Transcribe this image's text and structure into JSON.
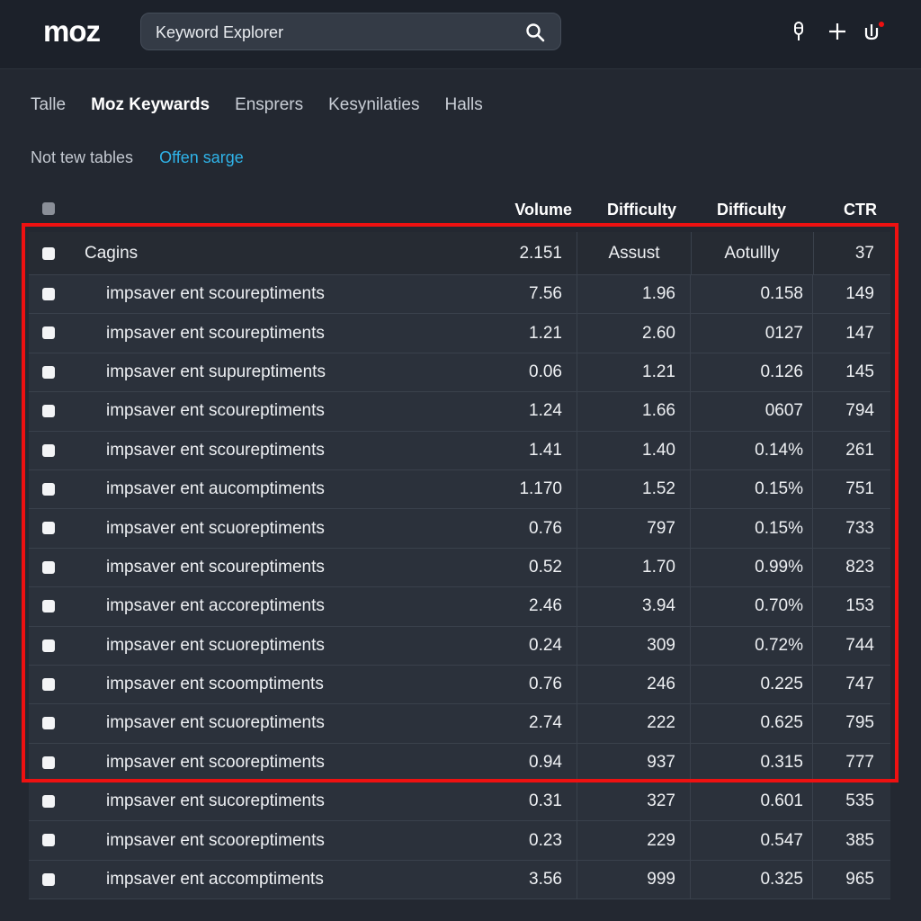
{
  "app": {
    "logo": "moz",
    "search_placeholder": "Keyword Explorer"
  },
  "icons": {
    "search": "search-icon",
    "microphone": "microphone-icon",
    "add": "plus-icon",
    "notifications": "notification-icon"
  },
  "colors": {
    "accent_link": "#2fb3e8",
    "highlight": "#ee1111"
  },
  "tabs": [
    {
      "label": "Talle",
      "active": false
    },
    {
      "label": "Moz Keywards",
      "active": true
    },
    {
      "label": "Ensprers",
      "active": false
    },
    {
      "label": "Kesynilaties",
      "active": false
    },
    {
      "label": "Halls",
      "active": false
    }
  ],
  "subrow": {
    "text": "Not tew tables",
    "link": "Offen sarge"
  },
  "table": {
    "columns": [
      "Volume",
      "Difficulty",
      "Difficulty",
      "CTR"
    ],
    "group_row": {
      "keyword": "Cagins",
      "c1": "2.151",
      "c2": "Assust",
      "c3": "Aotullly",
      "c4": "37"
    },
    "rows": [
      {
        "keyword": "impsaver ent scoureptiments",
        "c1": "7.56",
        "c2": "1.96",
        "c3": "0.158",
        "c4": "149"
      },
      {
        "keyword": "impsaver ent scoureptiments",
        "c1": "1.21",
        "c2": "2.60",
        "c3": "0127",
        "c4": "147"
      },
      {
        "keyword": "impsaver ent supureptiments",
        "c1": "0.06",
        "c2": "1.21",
        "c3": "0.126",
        "c4": "145"
      },
      {
        "keyword": "impsaver ent scoureptiments",
        "c1": "1.24",
        "c2": "1.66",
        "c3": "0607",
        "c4": "794"
      },
      {
        "keyword": "impsaver ent scoureptiments",
        "c1": "1.41",
        "c2": "1.40",
        "c3": "0.14%",
        "c4": "261"
      },
      {
        "keyword": "impsaver ent aucomptiments",
        "c1": "1.170",
        "c2": "1.52",
        "c3": "0.15%",
        "c4": "751"
      },
      {
        "keyword": "impsaver ent scuoreptiments",
        "c1": "0.76",
        "c2": "797",
        "c3": "0.15%",
        "c4": "733"
      },
      {
        "keyword": "impsaver ent scoureptiments",
        "c1": "0.52",
        "c2": "1.70",
        "c3": "0.99%",
        "c4": "823"
      },
      {
        "keyword": "impsaver ent accoreptiments",
        "c1": "2.46",
        "c2": "3.94",
        "c3": "0.70%",
        "c4": "153"
      },
      {
        "keyword": "impsaver ent scuoreptiments",
        "c1": "0.24",
        "c2": "309",
        "c3": "0.72%",
        "c4": "744"
      },
      {
        "keyword": "impsaver ent scoomptiments",
        "c1": "0.76",
        "c2": "246",
        "c3": "0.225",
        "c4": "747"
      },
      {
        "keyword": "impsaver ent scuoreptiments",
        "c1": "2.74",
        "c2": "222",
        "c3": "0.625",
        "c4": "795"
      },
      {
        "keyword": "impsaver ent scooreptiments",
        "c1": "0.94",
        "c2": "937",
        "c3": "0.315",
        "c4": "777"
      },
      {
        "keyword": "impsaver ent sucoreptiments",
        "c1": "0.31",
        "c2": "327",
        "c3": "0.601",
        "c4": "535"
      },
      {
        "keyword": "impsaver ent scooreptiments",
        "c1": "0.23",
        "c2": "229",
        "c3": "0.547",
        "c4": "385"
      },
      {
        "keyword": "impsaver ent accomptiments",
        "c1": "3.56",
        "c2": "999",
        "c3": "0.325",
        "c4": "965"
      }
    ]
  }
}
